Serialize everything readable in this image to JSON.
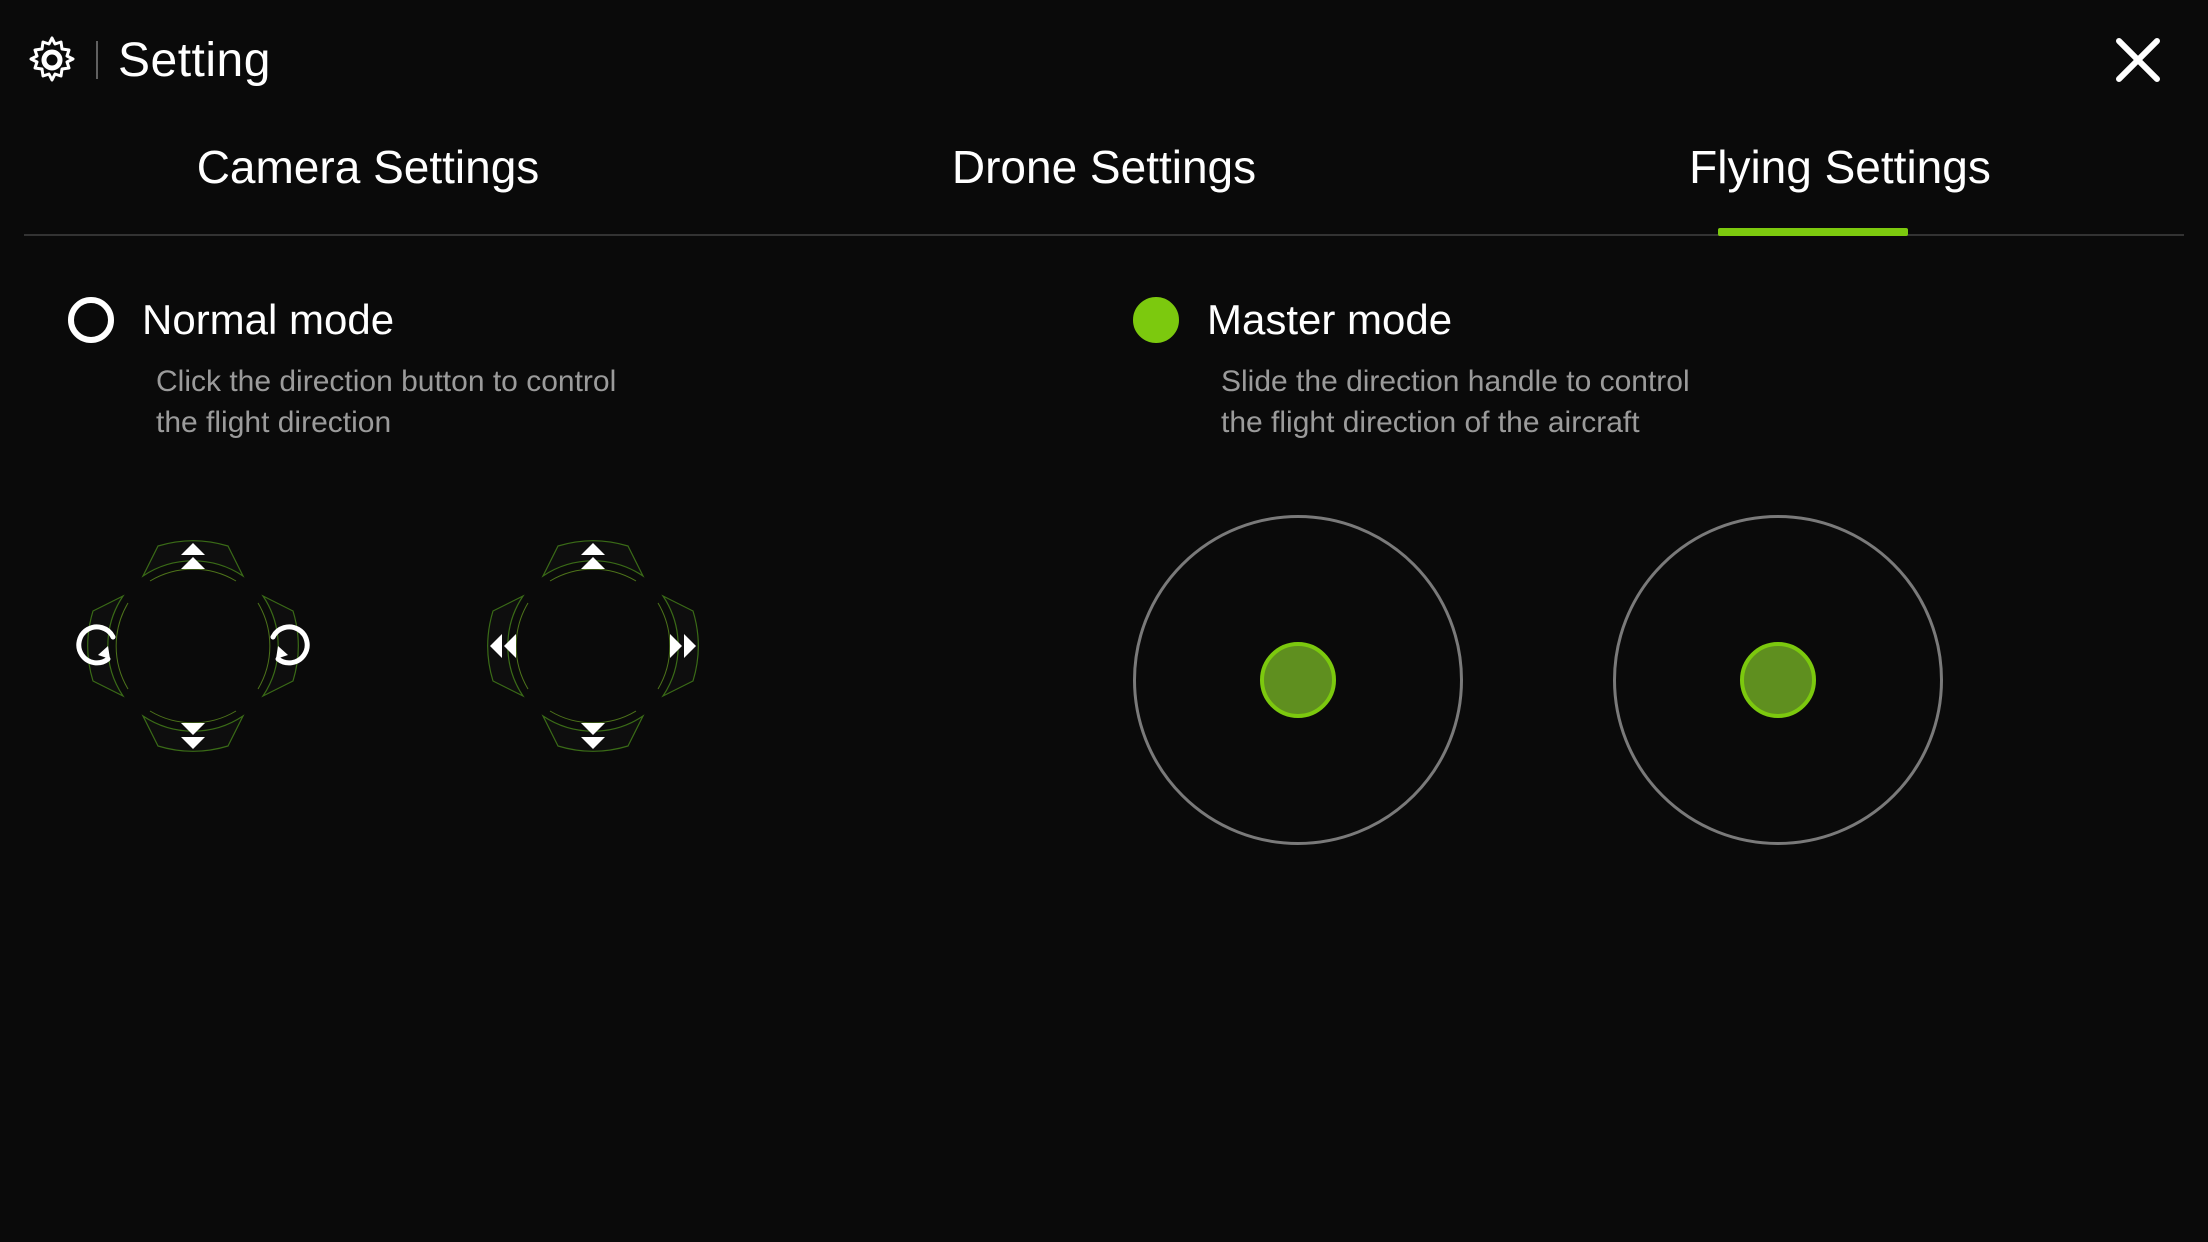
{
  "accent": "#7cc90e",
  "header": {
    "title": "Setting"
  },
  "tabs": [
    {
      "label": "Camera Settings",
      "active": false
    },
    {
      "label": "Drone Settings",
      "active": false
    },
    {
      "label": "Flying Settings",
      "active": true
    }
  ],
  "modes": {
    "normal": {
      "title": "Normal mode",
      "desc": "Click the direction button to control the flight direction",
      "selected": false
    },
    "master": {
      "title": "Master mode",
      "desc": "Slide the direction handle to control the flight direction of the aircraft",
      "selected": true
    }
  }
}
